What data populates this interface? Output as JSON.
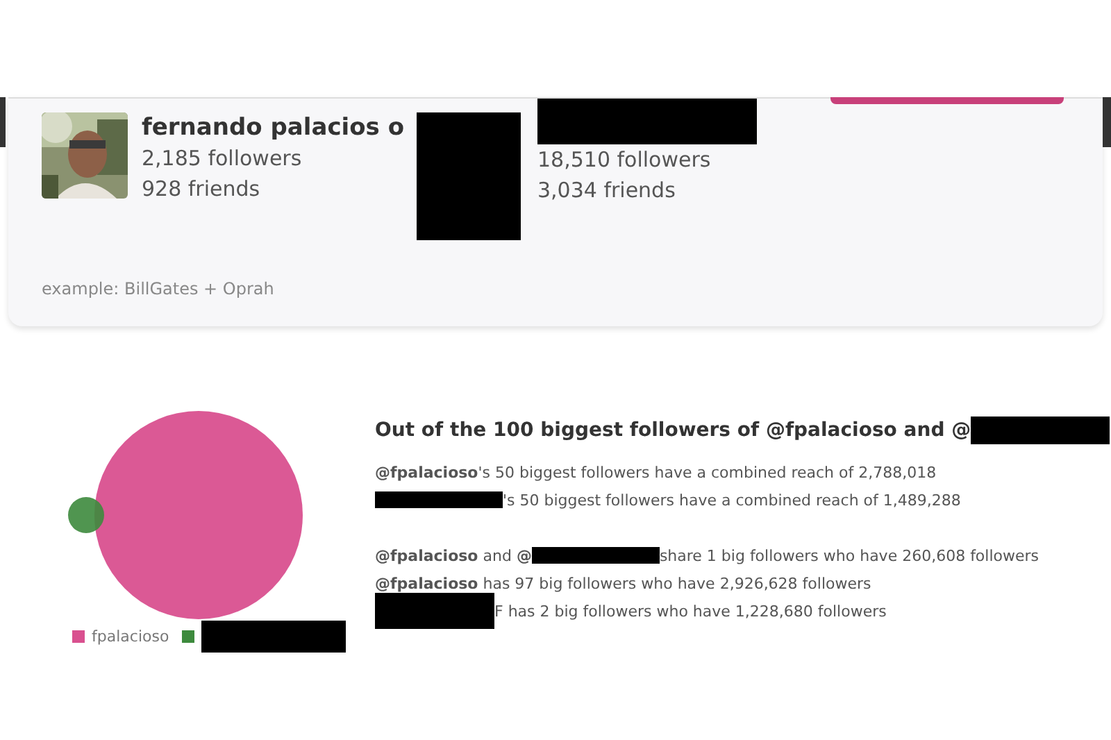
{
  "profiles": [
    {
      "name": "fernando palacios o",
      "followers": "2,185 followers",
      "friends": "928 friends",
      "kind": "shown"
    },
    {
      "followers": "18,510 followers",
      "friends": "3,034 friends",
      "kind": "redacted"
    }
  ],
  "example": "example: BillGates + Oprah",
  "comparison": {
    "title": [
      {
        "kind": "text",
        "text": "Out of the 100 biggest followers of @fpalacioso and @"
      },
      {
        "kind": "redacted"
      }
    ],
    "lines": [
      [
        {
          "kind": "text",
          "text": "**@fpalacioso**'s 50 biggest followers have a combined reach of 2,788,018"
        }
      ],
      [
        {
          "kind": "redacted"
        },
        {
          "kind": "text",
          "text": "'s 50 biggest followers have a combined reach of 1,489,288"
        }
      ],
      [
        {
          "kind": "gap"
        }
      ],
      [
        {
          "kind": "text",
          "text": "**@fpalacioso** and **@**"
        },
        {
          "kind": "redacted"
        },
        {
          "kind": "text",
          "text": " share 1 big followers who have 260,608 followers"
        }
      ],
      [
        {
          "kind": "text",
          "text": "**@fpalacioso** has 97 big followers who have 2,926,628 followers"
        }
      ],
      [
        {
          "kind": "redacted"
        },
        {
          "kind": "text",
          "text": "F has 2 big followers who have 1,228,680 followers"
        }
      ]
    ]
  },
  "legend": [
    {
      "label": "fpalacioso",
      "color": "#d9508f",
      "kind": "shown"
    },
    {
      "color": "#3d8a3d",
      "kind": "redacted"
    }
  ]
}
